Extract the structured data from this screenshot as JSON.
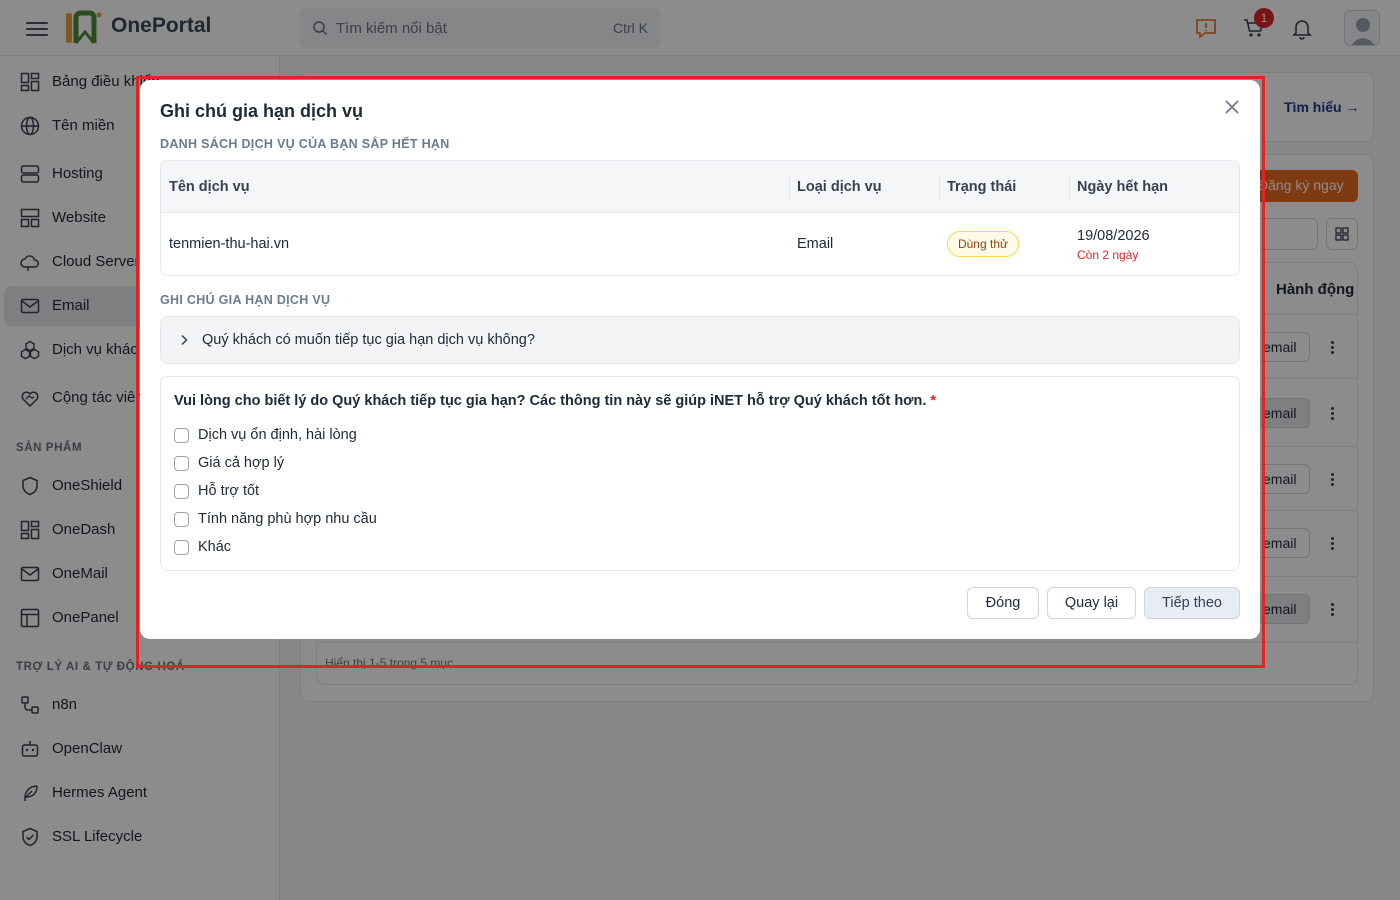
{
  "header": {
    "logo_text": "OnePortal",
    "search_placeholder": "Tìm kiếm nổi bật",
    "search_shortcut": "Ctrl K",
    "cart_count": "1",
    "colors": {
      "accent_orange": "#ea6a1f",
      "logo_green": "#4d8a3b",
      "badge_red": "#dc2626"
    }
  },
  "sidebar": {
    "items": [
      {
        "label": "Bảng điều khiển",
        "icon": "dashboard-icon"
      },
      {
        "label": "Tên miền",
        "icon": "globe-icon"
      },
      {
        "label": "Hosting",
        "icon": "server-icon"
      },
      {
        "label": "Website",
        "icon": "layout-icon"
      },
      {
        "label": "Cloud Server",
        "icon": "cloud-icon"
      },
      {
        "label": "Email",
        "icon": "mail-icon"
      },
      {
        "label": "Dịch vụ khác",
        "icon": "boxes-icon"
      },
      {
        "label": "Cộng tác viên",
        "icon": "heart-handshake-icon"
      }
    ],
    "section_products": "SẢN PHẨM",
    "products": [
      {
        "label": "OneShield",
        "icon": "shield-icon"
      },
      {
        "label": "OneDash",
        "icon": "dashboard-icon"
      },
      {
        "label": "OneMail",
        "icon": "mail-icon"
      },
      {
        "label": "OnePanel",
        "icon": "panel-icon"
      }
    ],
    "section_ai": "TRỢ LÝ AI & TỰ ĐỘNG HOÁ",
    "ai": [
      {
        "label": "n8n",
        "icon": "workflow-icon"
      },
      {
        "label": "OpenClaw",
        "icon": "bot-icon"
      },
      {
        "label": "Hermes Agent",
        "icon": "feather-icon"
      },
      {
        "label": "SSL Lifecycle",
        "icon": "shield-check-icon"
      }
    ]
  },
  "background": {
    "learn_more": "Tìm hiểu",
    "register_button": "Đăng ký ngay",
    "actions_header": "Hành động",
    "row_button_text": "email",
    "footer_text": "Hiển thị 1-5 trong 5 mục"
  },
  "modal": {
    "title": "Ghi chú gia hạn dịch vụ",
    "section_services": "DANH SÁCH DỊCH VỤ CỦA BẠN SẮP HẾT HẠN",
    "columns": [
      "Tên dịch vụ",
      "Loại dịch vụ",
      "Trạng thái",
      "Ngày hết hạn"
    ],
    "row": {
      "name": "tenmien-thu-hai.vn",
      "type": "Email",
      "status": "Dùng thử",
      "expiry": "19/08/2026",
      "remaining": "Còn 2 ngày"
    },
    "section_note": "GHI CHÚ GIA HẠN DỊCH VỤ",
    "accordion_question": "Quý khách có muốn tiếp tục gia hạn dịch vụ không?",
    "reason_question": "Vui lòng cho biết lý do Quý khách tiếp tục gia hạn? Các thông tin này sẽ giúp iNET hỗ trợ Quý khách tốt hơn.",
    "required_mark": "*",
    "options": [
      "Dịch vụ ổn định, hài lòng",
      "Giá cả hợp lý",
      "Hỗ trợ tốt",
      "Tính năng phù hợp nhu cầu",
      "Khác"
    ],
    "buttons": {
      "close": "Đóng",
      "back": "Quay lại",
      "next": "Tiếp theo"
    }
  }
}
